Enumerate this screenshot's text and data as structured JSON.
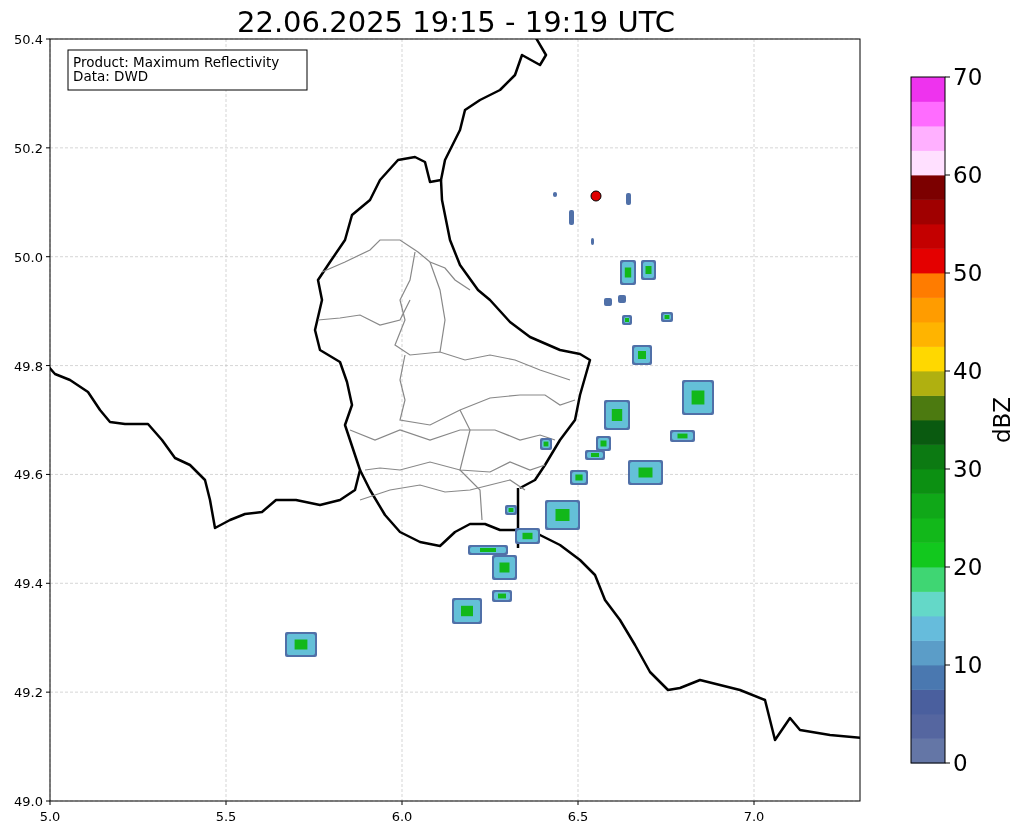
{
  "title": "22.06.2025 19:15 - 19:19 UTC",
  "info_box": {
    "lines": [
      "Product: Maximum Reflectivity",
      "Data: DWD"
    ]
  },
  "map": {
    "x_ticks": [
      "5.0",
      "5.5",
      "6.0",
      "6.5",
      "7.0"
    ],
    "y_ticks": [
      "50.4",
      "50.2",
      "50.0",
      "49.8",
      "49.6",
      "49.4",
      "49.2",
      "49.0"
    ]
  },
  "colorbar": {
    "label": "dBZ",
    "ticks": [
      "70",
      "60",
      "50",
      "40",
      "30",
      "20",
      "10",
      "0"
    ],
    "bands": [
      {
        "color": "#6476a6"
      },
      {
        "color": "#5566a0"
      },
      {
        "color": "#4a5f9e"
      },
      {
        "color": "#4a78b0"
      },
      {
        "color": "#5b9dc8"
      },
      {
        "color": "#66bcdc"
      },
      {
        "color": "#64d8c8"
      },
      {
        "color": "#3fd673"
      },
      {
        "color": "#12c81e"
      },
      {
        "color": "#12b81a"
      },
      {
        "color": "#10a818"
      },
      {
        "color": "#0c9012"
      },
      {
        "color": "#0c7a12"
      },
      {
        "color": "#0a5a10"
      },
      {
        "color": "#4c7a10"
      },
      {
        "color": "#b0b010"
      },
      {
        "color": "#ffd800"
      },
      {
        "color": "#ffb400"
      },
      {
        "color": "#ff9c00"
      },
      {
        "color": "#ff7c00"
      },
      {
        "color": "#e40000"
      },
      {
        "color": "#c40000"
      },
      {
        "color": "#a00000"
      },
      {
        "color": "#7c0000"
      },
      {
        "color": "#ffe0ff"
      },
      {
        "color": "#ffb0ff"
      },
      {
        "color": "#ff6cff"
      },
      {
        "color": "#ee33ee"
      }
    ]
  }
}
